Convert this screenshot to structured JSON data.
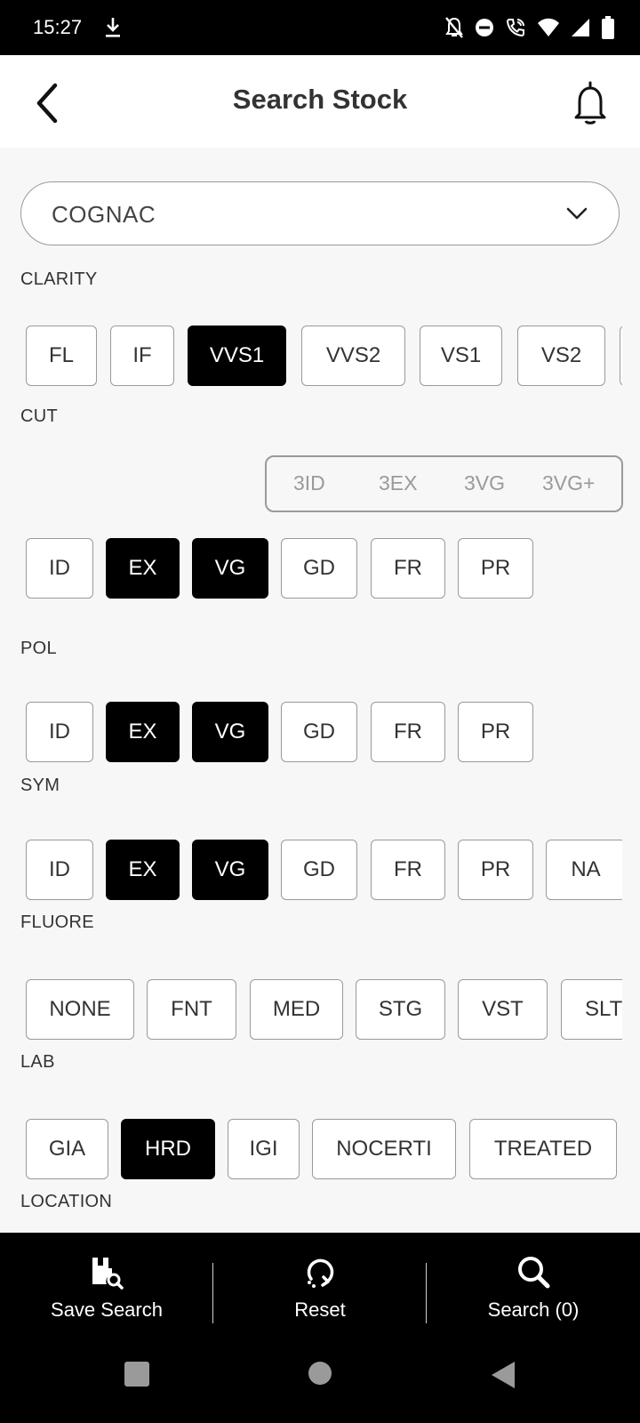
{
  "status_bar": {
    "time": "15:27",
    "icons": [
      "download-icon",
      "notifications-off-icon",
      "do-not-disturb-icon",
      "wifi-calling-icon",
      "wifi-icon",
      "signal-icon",
      "battery-icon"
    ]
  },
  "header": {
    "title": "Search Stock",
    "back_icon": "chevron-left-icon",
    "bell_icon": "bell-icon"
  },
  "shape_select": {
    "value": "COGNAC"
  },
  "sections": {
    "clarity": {
      "label": "CLARITY",
      "options": [
        {
          "label": "FL",
          "selected": false
        },
        {
          "label": "IF",
          "selected": false
        },
        {
          "label": "VVS1",
          "selected": true
        },
        {
          "label": "VVS2",
          "selected": false
        },
        {
          "label": "VS1",
          "selected": false
        },
        {
          "label": "VS2",
          "selected": false
        }
      ]
    },
    "cut": {
      "label": "CUT",
      "quick_types": [
        "3ID",
        "3EX",
        "3VG",
        "3VG+"
      ],
      "options": [
        {
          "label": "ID",
          "selected": false
        },
        {
          "label": "EX",
          "selected": true
        },
        {
          "label": "VG",
          "selected": true
        },
        {
          "label": "GD",
          "selected": false
        },
        {
          "label": "FR",
          "selected": false
        },
        {
          "label": "PR",
          "selected": false
        }
      ]
    },
    "pol": {
      "label": "POL",
      "options": [
        {
          "label": "ID",
          "selected": false
        },
        {
          "label": "EX",
          "selected": true
        },
        {
          "label": "VG",
          "selected": true
        },
        {
          "label": "GD",
          "selected": false
        },
        {
          "label": "FR",
          "selected": false
        },
        {
          "label": "PR",
          "selected": false
        }
      ]
    },
    "sym": {
      "label": "SYM",
      "options": [
        {
          "label": "ID",
          "selected": false
        },
        {
          "label": "EX",
          "selected": true
        },
        {
          "label": "VG",
          "selected": true
        },
        {
          "label": "GD",
          "selected": false
        },
        {
          "label": "FR",
          "selected": false
        },
        {
          "label": "PR",
          "selected": false
        },
        {
          "label": "NA",
          "selected": false
        }
      ]
    },
    "fluore": {
      "label": "FLUORE",
      "options": [
        {
          "label": "NONE",
          "selected": false
        },
        {
          "label": "FNT",
          "selected": false
        },
        {
          "label": "MED",
          "selected": false
        },
        {
          "label": "STG",
          "selected": false
        },
        {
          "label": "VST",
          "selected": false
        },
        {
          "label": "SLT",
          "selected": false
        }
      ]
    },
    "lab": {
      "label": "LAB",
      "options": [
        {
          "label": "GIA",
          "selected": false
        },
        {
          "label": "HRD",
          "selected": true
        },
        {
          "label": "IGI",
          "selected": false
        },
        {
          "label": "NOCERTI",
          "selected": false
        },
        {
          "label": "TREATED",
          "selected": false
        }
      ]
    },
    "location": {
      "label": "LOCATION"
    }
  },
  "bottom_actions": {
    "save": {
      "label": "Save Search",
      "icon": "save-search-icon"
    },
    "reset": {
      "label": "Reset",
      "icon": "reset-icon"
    },
    "search": {
      "label": "Search (0)",
      "icon": "search-icon"
    }
  },
  "nav_bar": {
    "recents": "square-icon",
    "home": "circle-icon",
    "back": "triangle-back-icon"
  },
  "colors": {
    "selected_bg": "#000000",
    "chip_border": "#9a9a9a",
    "page_bg": "#f7f7f7"
  }
}
